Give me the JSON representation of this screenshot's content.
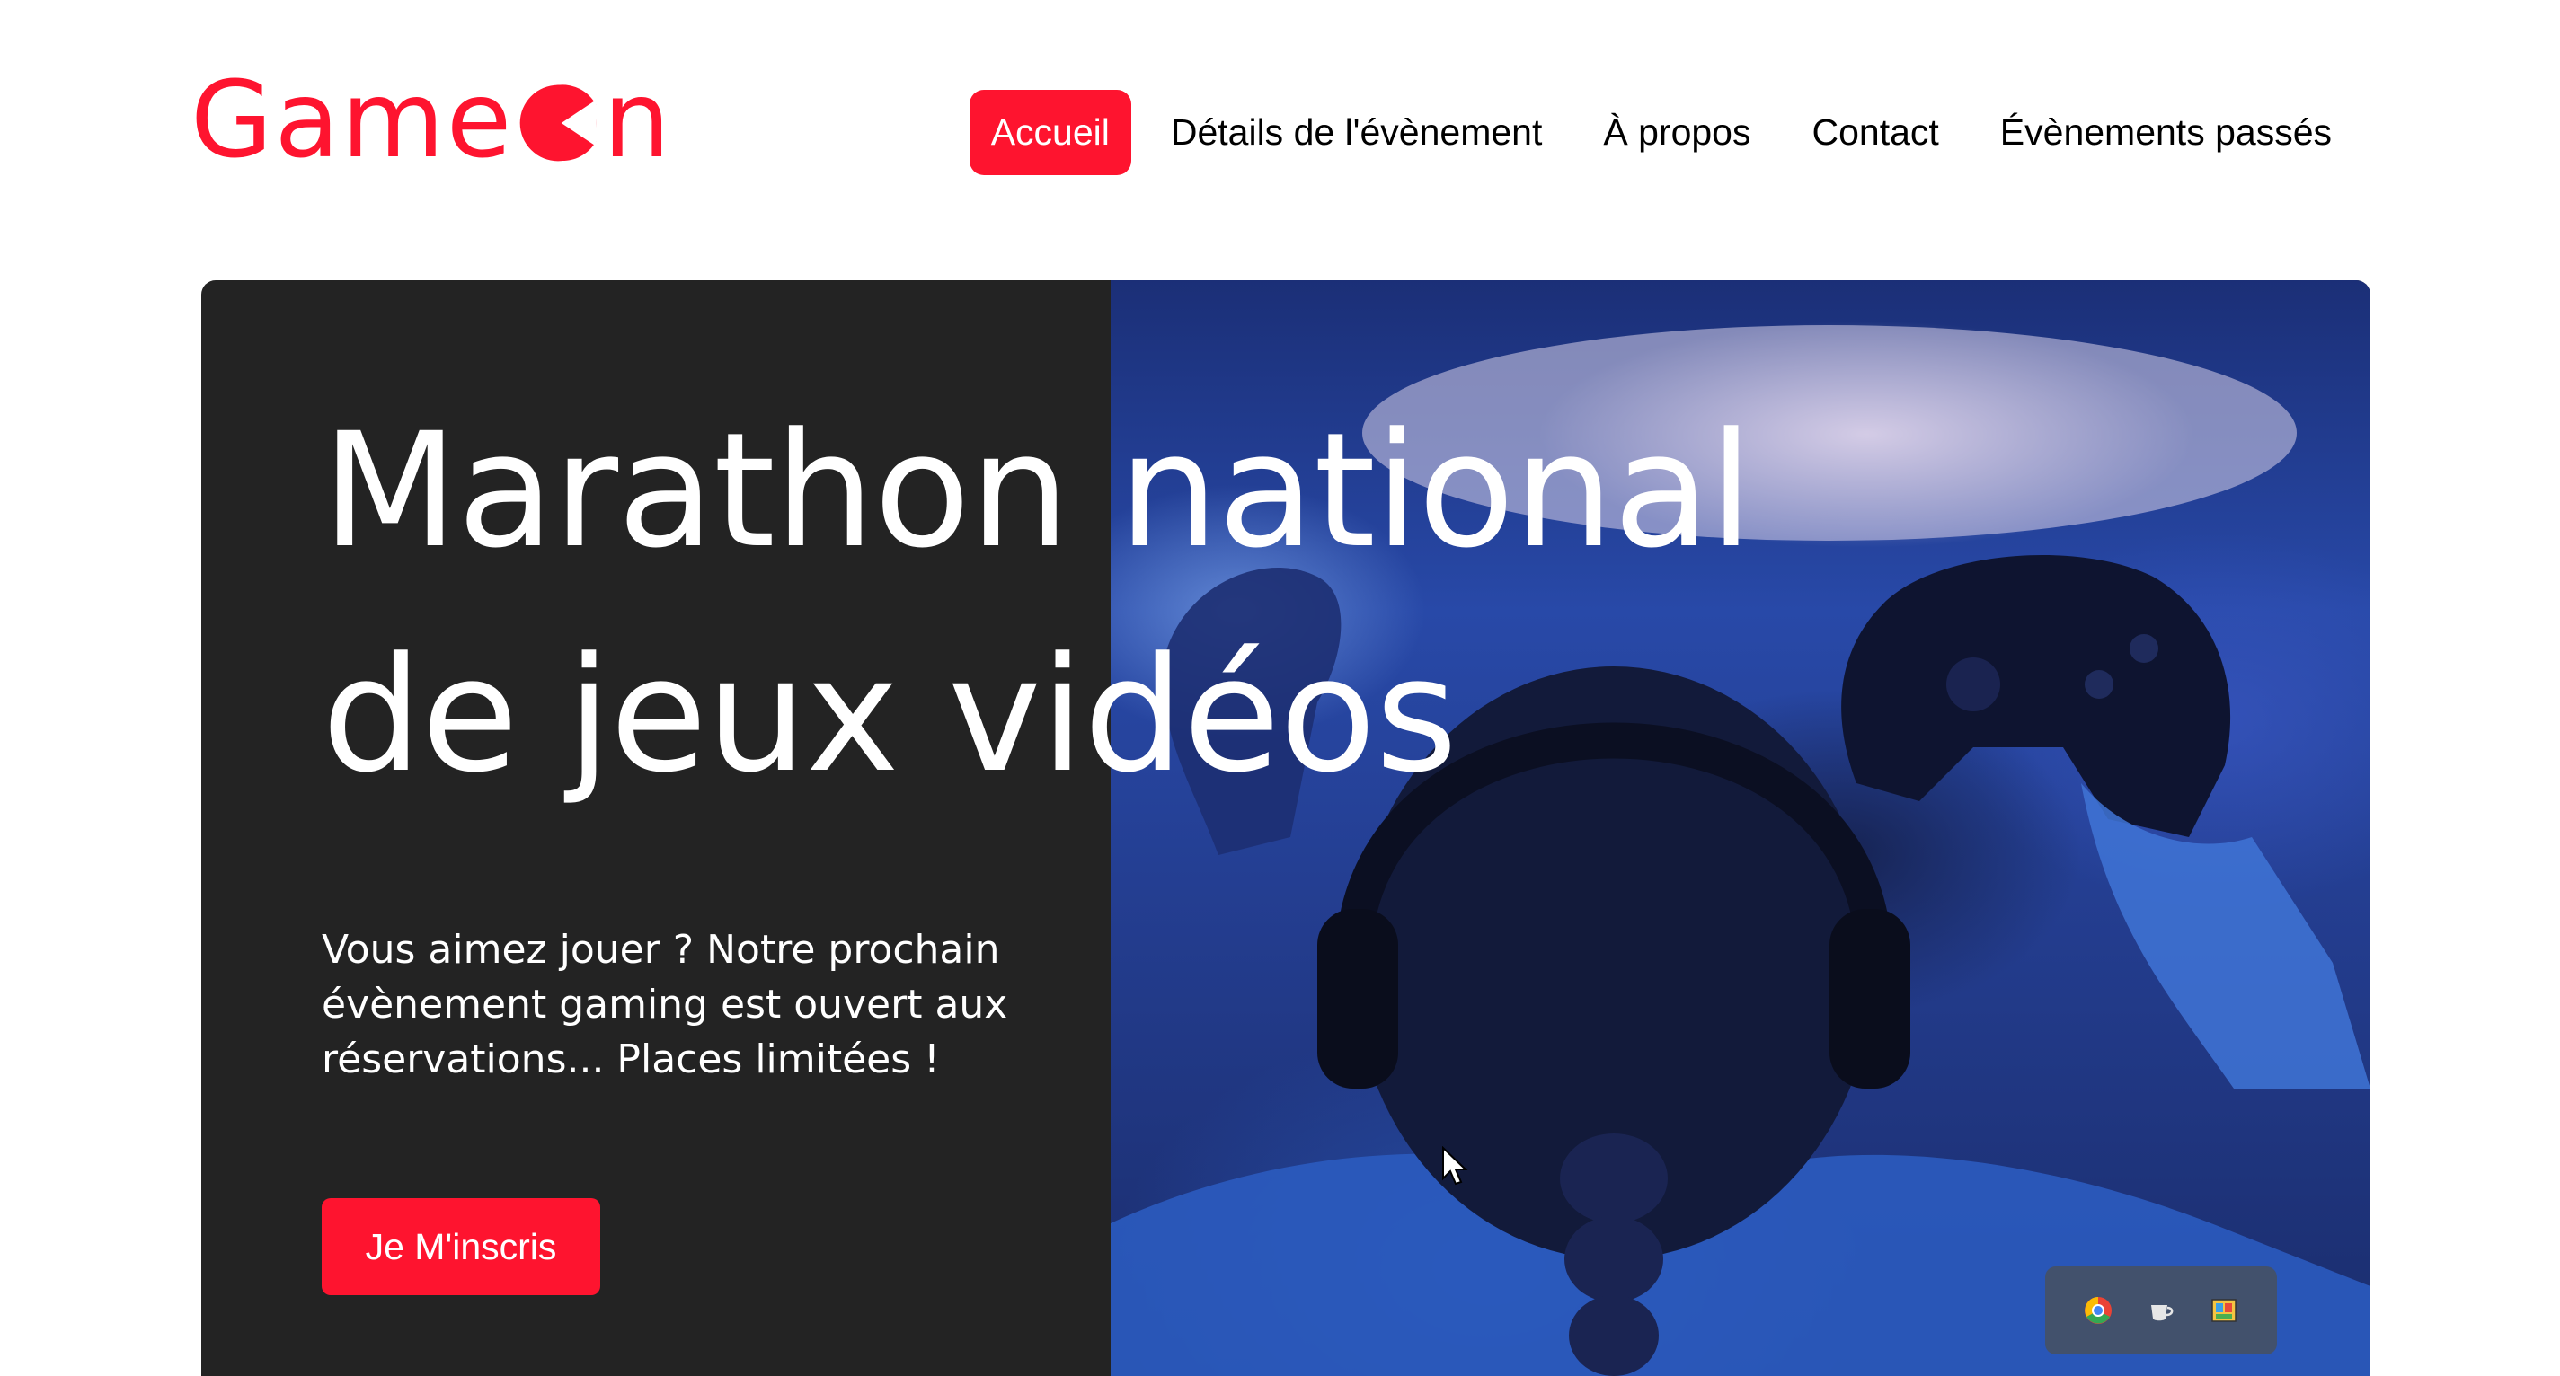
{
  "brand": {
    "logo_text_before": "Game",
    "logo_text_after": "n",
    "accent_color": "#fe142f"
  },
  "nav": {
    "items": [
      {
        "label": "Accueil",
        "active": true
      },
      {
        "label": "Détails de l'évènement",
        "active": false
      },
      {
        "label": "À propos",
        "active": false
      },
      {
        "label": "Contact",
        "active": false
      },
      {
        "label": "Évènements passés",
        "active": false
      }
    ]
  },
  "hero": {
    "title": "Marathon national\nde jeux vidéos",
    "text": "Vous aimez jouer ? Notre prochain évènement gaming est ouvert aux réservations... Places limitées !",
    "cta_label": "Je M'inscris",
    "panel_color": "#232323"
  },
  "floating_toolbar": {
    "icons": [
      "chrome-icon",
      "coffee-cup-icon",
      "photo-gallery-icon"
    ]
  }
}
